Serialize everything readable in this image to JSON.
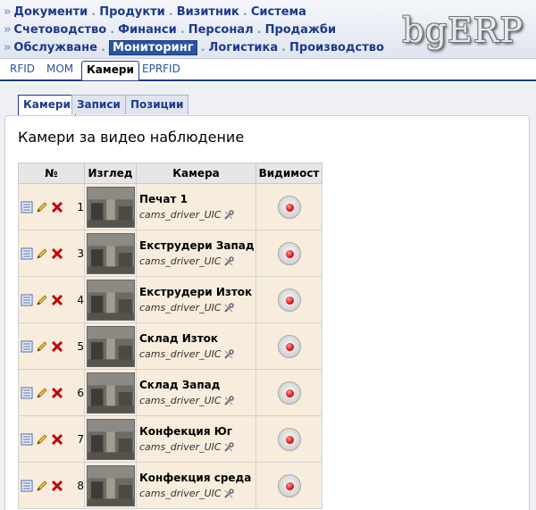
{
  "menu": {
    "rows": [
      [
        "Документи",
        "Продукти",
        "Визитник",
        "Система"
      ],
      [
        "Счетоводство",
        "Финанси",
        "Персонал",
        "Продажби"
      ],
      [
        "Обслужване",
        "Мониторинг",
        "Логистика",
        "Производство"
      ]
    ],
    "active": "Мониторинг",
    "lead": "»",
    "sep": "."
  },
  "logo": "bgERP",
  "subnav": [
    "RFID",
    "MOM",
    "Камери",
    "EPRFID"
  ],
  "subnav_active": "Камери",
  "tabs": [
    "Камери",
    "Записи",
    "Позиции"
  ],
  "tabs_active": "Камери",
  "page_title": "Камери за видео наблюдение",
  "table": {
    "headers": [
      "№",
      "Изглед",
      "Камера",
      "Видимост"
    ],
    "rows": [
      {
        "num": "1",
        "name": "Печат 1",
        "driver": "cams_driver_UIC"
      },
      {
        "num": "3",
        "name": "Екструдери Запад",
        "driver": "cams_driver_UIC"
      },
      {
        "num": "4",
        "name": "Екструдери Изток",
        "driver": "cams_driver_UIC"
      },
      {
        "num": "5",
        "name": "Склад Изток",
        "driver": "cams_driver_UIC"
      },
      {
        "num": "6",
        "name": "Склад Запад",
        "driver": "cams_driver_UIC"
      },
      {
        "num": "7",
        "name": "Конфекция Юг",
        "driver": "cams_driver_UIC"
      },
      {
        "num": "8",
        "name": "Конфекция среда",
        "driver": "cams_driver_UIC"
      }
    ]
  },
  "icons": [
    "list-icon",
    "edit-pencil-icon",
    "delete-x-icon",
    "wrench-icon",
    "visibility-record-icon"
  ],
  "colors": {
    "menu_link": "#1b3a8b",
    "row_bg": "#f8ecdc",
    "active_bg": "#2a54a0"
  }
}
